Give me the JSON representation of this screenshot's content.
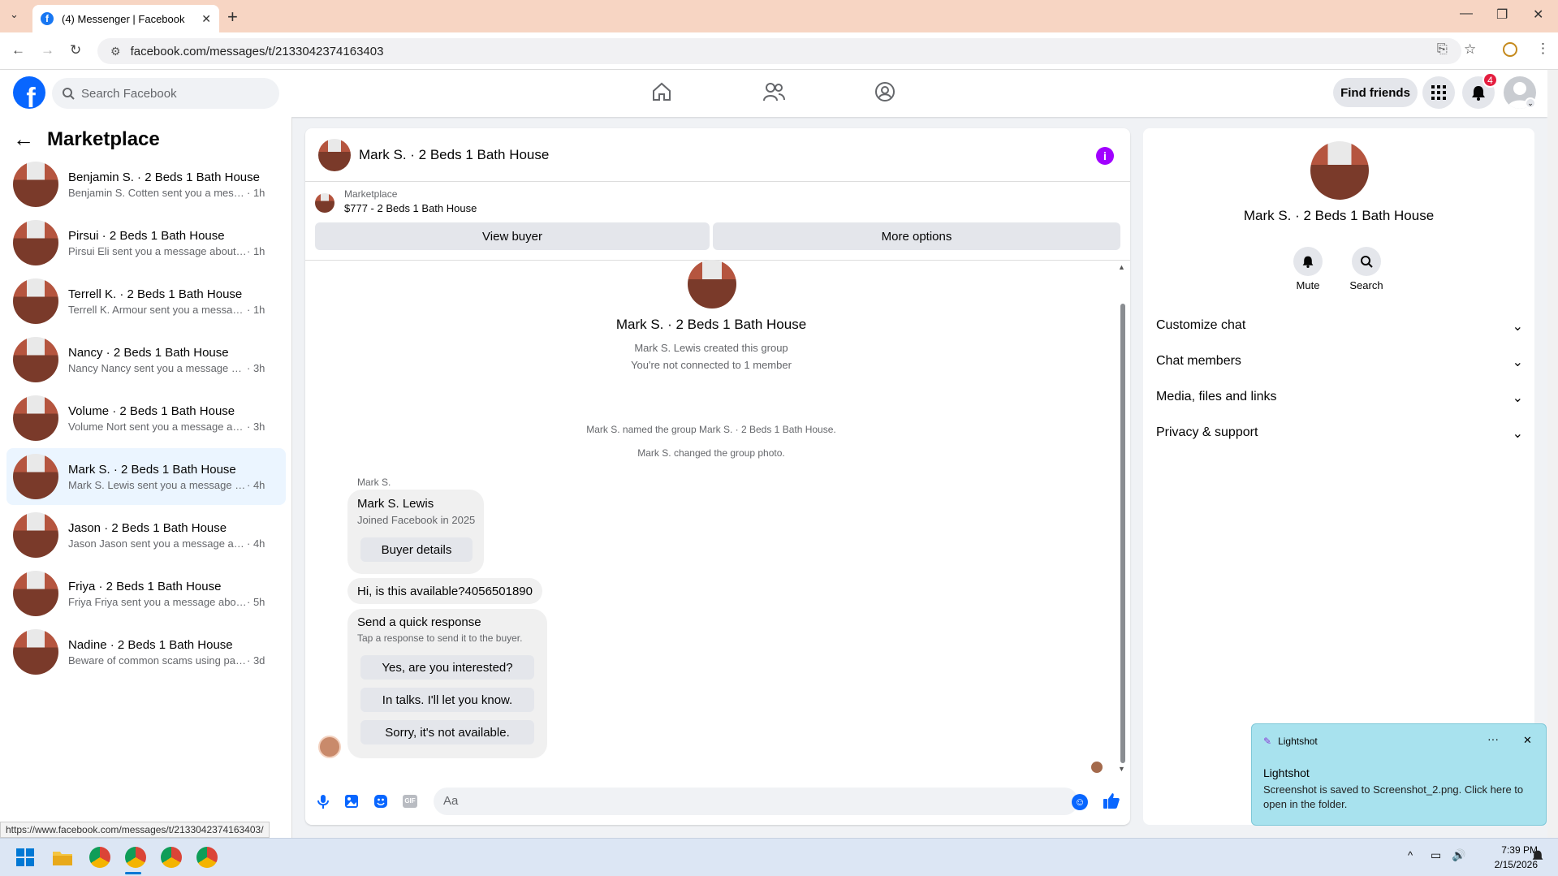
{
  "browser": {
    "tab_title": "(4) Messenger | Facebook",
    "url": "facebook.com/messages/t/2133042374163403",
    "status_url": "https://www.facebook.com/messages/t/2133042374163403/"
  },
  "fb": {
    "search_placeholder": "Search Facebook",
    "find_friends": "Find friends",
    "notif_count": "4"
  },
  "sidebar": {
    "title": "Marketplace",
    "conversations": [
      {
        "title": "Benjamin S. · 2 Beds 1 Bath House",
        "preview": "Benjamin S. Cotten sent you a messag...",
        "time": "· 1h"
      },
      {
        "title": "Pirsui · 2 Beds 1 Bath House",
        "preview": "Pirsui Eli sent you a message about yo...",
        "time": "· 1h"
      },
      {
        "title": "Terrell K. · 2 Beds 1 Bath House",
        "preview": "Terrell K. Armour sent you a message ...",
        "time": "· 1h"
      },
      {
        "title": "Nancy · 2 Beds 1 Bath House",
        "preview": "Nancy Nancy sent you a message abo...",
        "time": "· 3h"
      },
      {
        "title": "Volume · 2 Beds 1 Bath House",
        "preview": "Volume Nort sent you a message abo...",
        "time": "· 3h"
      },
      {
        "title": "Mark S. · 2 Beds 1 Bath House",
        "preview": "Mark S. Lewis sent you a message ab...",
        "time": "· 4h"
      },
      {
        "title": "Jason · 2 Beds 1 Bath House",
        "preview": "Jason Jason sent you a message abou...",
        "time": "· 4h"
      },
      {
        "title": "Friya · 2 Beds 1 Bath House",
        "preview": "Friya Friya sent you a message about ...",
        "time": "· 5h"
      },
      {
        "title": "Nadine · 2 Beds 1 Bath House",
        "preview": "Beware of common scams using pay...",
        "time": "· 3d"
      }
    ]
  },
  "chat": {
    "title": "Mark S. · 2 Beds 1 Bath House",
    "listing_label": "Marketplace",
    "listing_item": "$777 - 2 Beds 1 Bath House",
    "view_buyer": "View buyer",
    "more_options": "More options",
    "group_name": "Mark S. · 2 Beds 1 Bath House",
    "created": "Mark S. Lewis created this group",
    "not_connected": "You're not connected to 1 member",
    "named_event": "Mark S. named the group Mark S. · 2 Beds 1 Bath House.",
    "photo_event": "Mark S. changed the group photo.",
    "sender": "Mark S.",
    "card_name": "Mark S. Lewis",
    "card_joined": "Joined Facebook in 2025",
    "buyer_details": "Buyer details",
    "message": "Hi, is this available?4056501890",
    "quick_title": "Send a quick response",
    "quick_sub": "Tap a response to send it to the buyer.",
    "quick_replies": [
      "Yes, are you interested?",
      "In talks. I'll let you know.",
      "Sorry, it's not available."
    ],
    "input_placeholder": "Aa"
  },
  "details": {
    "name": "Mark S. · 2 Beds 1 Bath House",
    "mute": "Mute",
    "search": "Search",
    "sections": [
      "Customize chat",
      "Chat members",
      "Media, files and links",
      "Privacy & support"
    ]
  },
  "toast": {
    "app": "Lightshot",
    "title": "Lightshot",
    "body": "Screenshot is saved to Screenshot_2.png. Click here to open in the folder."
  },
  "taskbar": {
    "time": "7:39 PM",
    "date": "2/15/2026"
  }
}
